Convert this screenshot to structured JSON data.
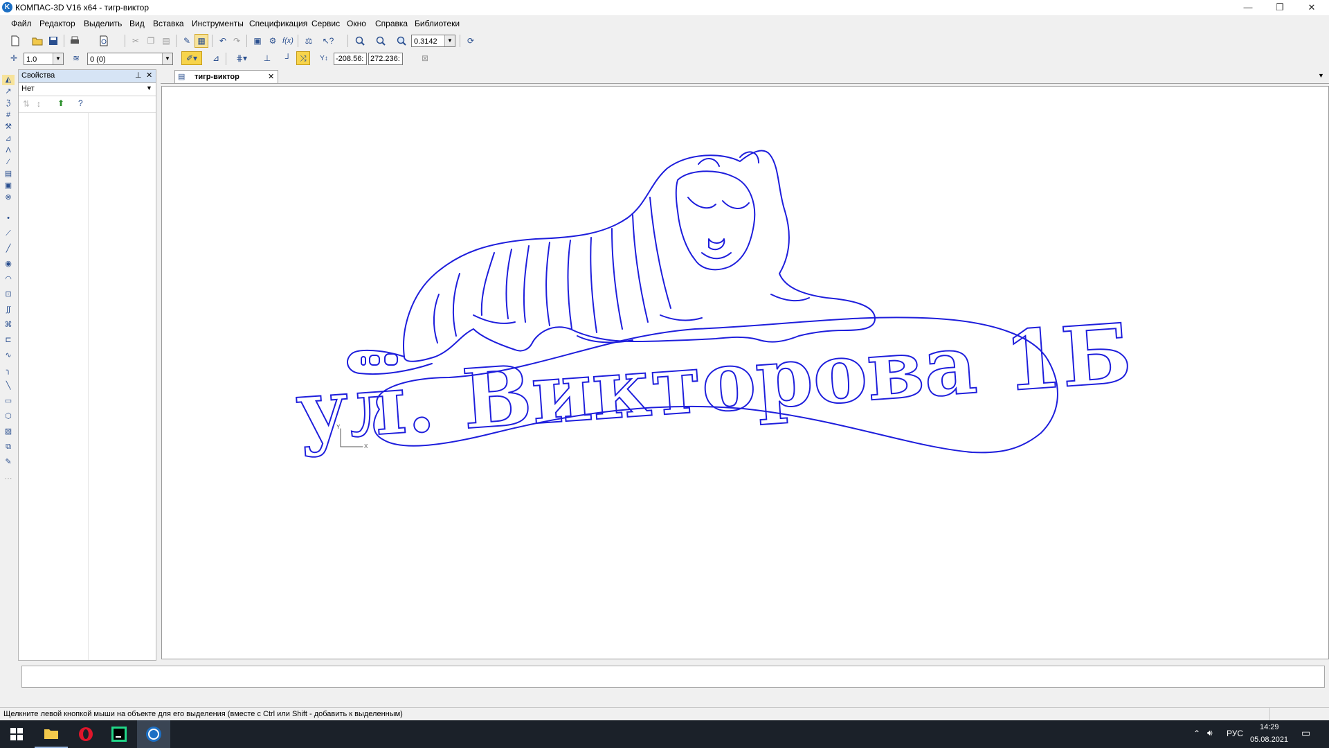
{
  "window": {
    "title": "КОМПАС-3D V16  x64 - тигр-виктор",
    "app_icon": "K",
    "controls": [
      "—",
      "❐",
      "✕"
    ]
  },
  "menu": {
    "items": [
      "Файл",
      "Редактор",
      "Выделить",
      "Вид",
      "Вставка",
      "Инструменты",
      "Спецификация",
      "Сервис",
      "Окно",
      "Справка",
      "Библиотеки"
    ]
  },
  "toolbar_standard": {
    "zoom_value": "0.3142"
  },
  "toolbar_current": {
    "step_value": "1.0",
    "layer_value": "0 (0)",
    "coord_x": "-208.56:",
    "coord_y": "272.236:"
  },
  "properties_panel": {
    "title": "Свойства",
    "selection": "Нет"
  },
  "document": {
    "tab_label": "тигр-виктор",
    "tab_close": "✕",
    "drawing": {
      "sign_text": "ул. Викторова 1Б",
      "stroke_color": "#1e1edc",
      "axis_y": "Y",
      "axis_x": "X"
    }
  },
  "status": {
    "hint": "Щелкните левой кнопкой мыши на объекте для его выделения (вместе с Ctrl или Shift - добавить к выделенным)"
  },
  "taskbar": {
    "apps": [
      "windows-start",
      "file-explorer",
      "opera-browser",
      "pycharm",
      "kompas-3d"
    ],
    "lang": "РУС",
    "time": "14:29",
    "date": "05.08.2021"
  }
}
